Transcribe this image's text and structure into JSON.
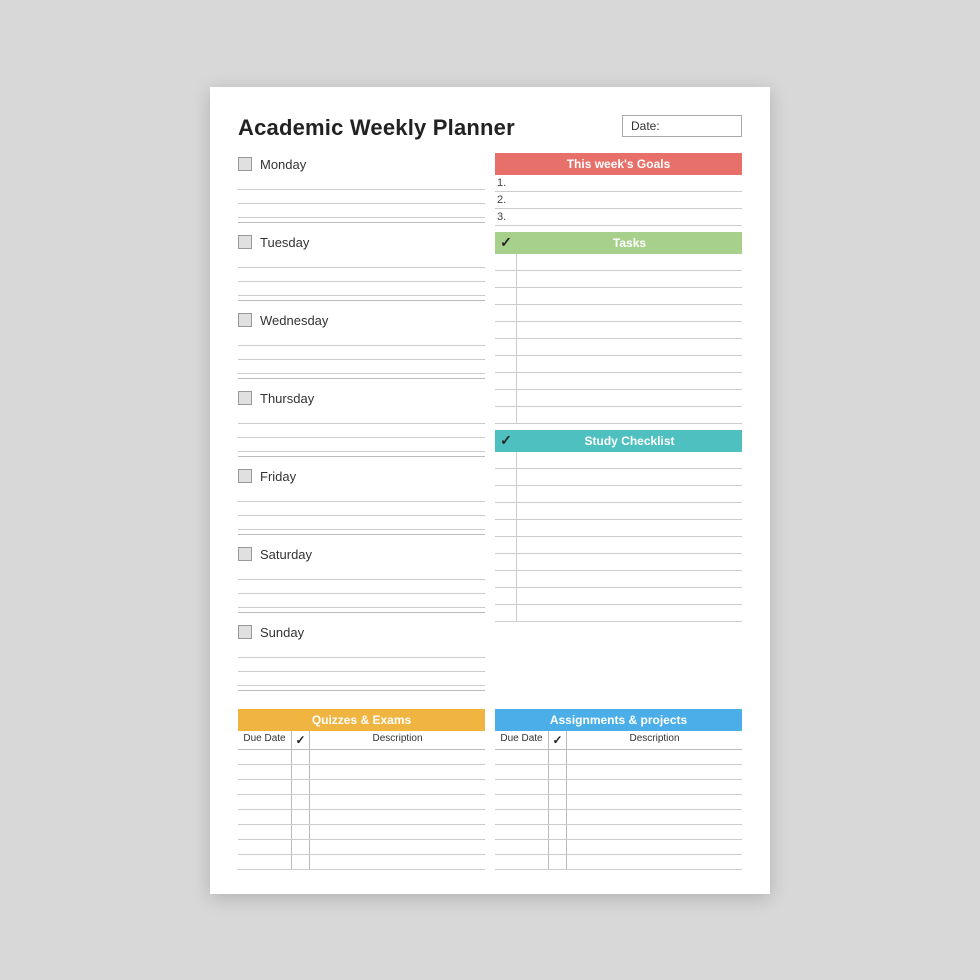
{
  "title": "Academic Weekly Planner",
  "date_label": "Date:",
  "days": [
    {
      "label": "Monday",
      "lines": 3
    },
    {
      "label": "Tuesday",
      "lines": 3
    },
    {
      "label": "Wednesday",
      "lines": 3
    },
    {
      "label": "Thursday",
      "lines": 3
    },
    {
      "label": "Friday",
      "lines": 3
    },
    {
      "label": "Saturday",
      "lines": 3
    },
    {
      "label": "Sunday",
      "lines": 3
    }
  ],
  "goals": {
    "header": "This week's Goals",
    "items": [
      "1.",
      "2.",
      "3."
    ]
  },
  "tasks": {
    "header": "Tasks",
    "check_icon": "✓",
    "row_count": 10
  },
  "study": {
    "header": "Study Checklist",
    "check_icon": "✓",
    "row_count": 10
  },
  "quizzes": {
    "header": "Quizzes & Exams",
    "col_due": "Due Date",
    "col_check": "✓",
    "col_desc": "Description",
    "row_count": 8
  },
  "assignments": {
    "header": "Assignments & projects",
    "col_due": "Due Date",
    "col_check": "✓",
    "col_desc": "Description",
    "row_count": 8
  }
}
